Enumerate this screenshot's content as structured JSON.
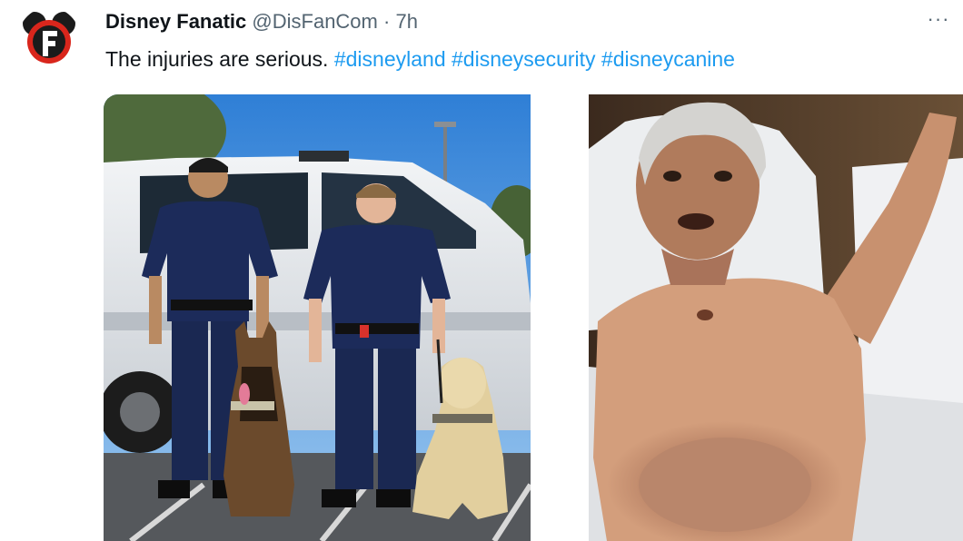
{
  "tweet": {
    "author_name": "Disney Fanatic",
    "author_handle": "@DisFanCom",
    "separator": "·",
    "time": "7h",
    "more_label": "···",
    "text_plain": "The injuries are serious.",
    "hashtags": [
      "#disneyland",
      "#disneysecurity",
      "#disneycanine"
    ]
  },
  "avatar": {
    "icon": "disney-fanatic-logo-icon",
    "colors": {
      "ring": "#d9261c",
      "ears": "#1b1b1b",
      "letter": "#ffffff"
    }
  },
  "media": {
    "images": [
      {
        "name": "security-officers-with-dogs-photo"
      },
      {
        "name": "injured-man-in-bed-photo"
      }
    ]
  },
  "colors": {
    "name": "#0f1419",
    "secondary": "#536471",
    "link": "#1d9bf0"
  }
}
